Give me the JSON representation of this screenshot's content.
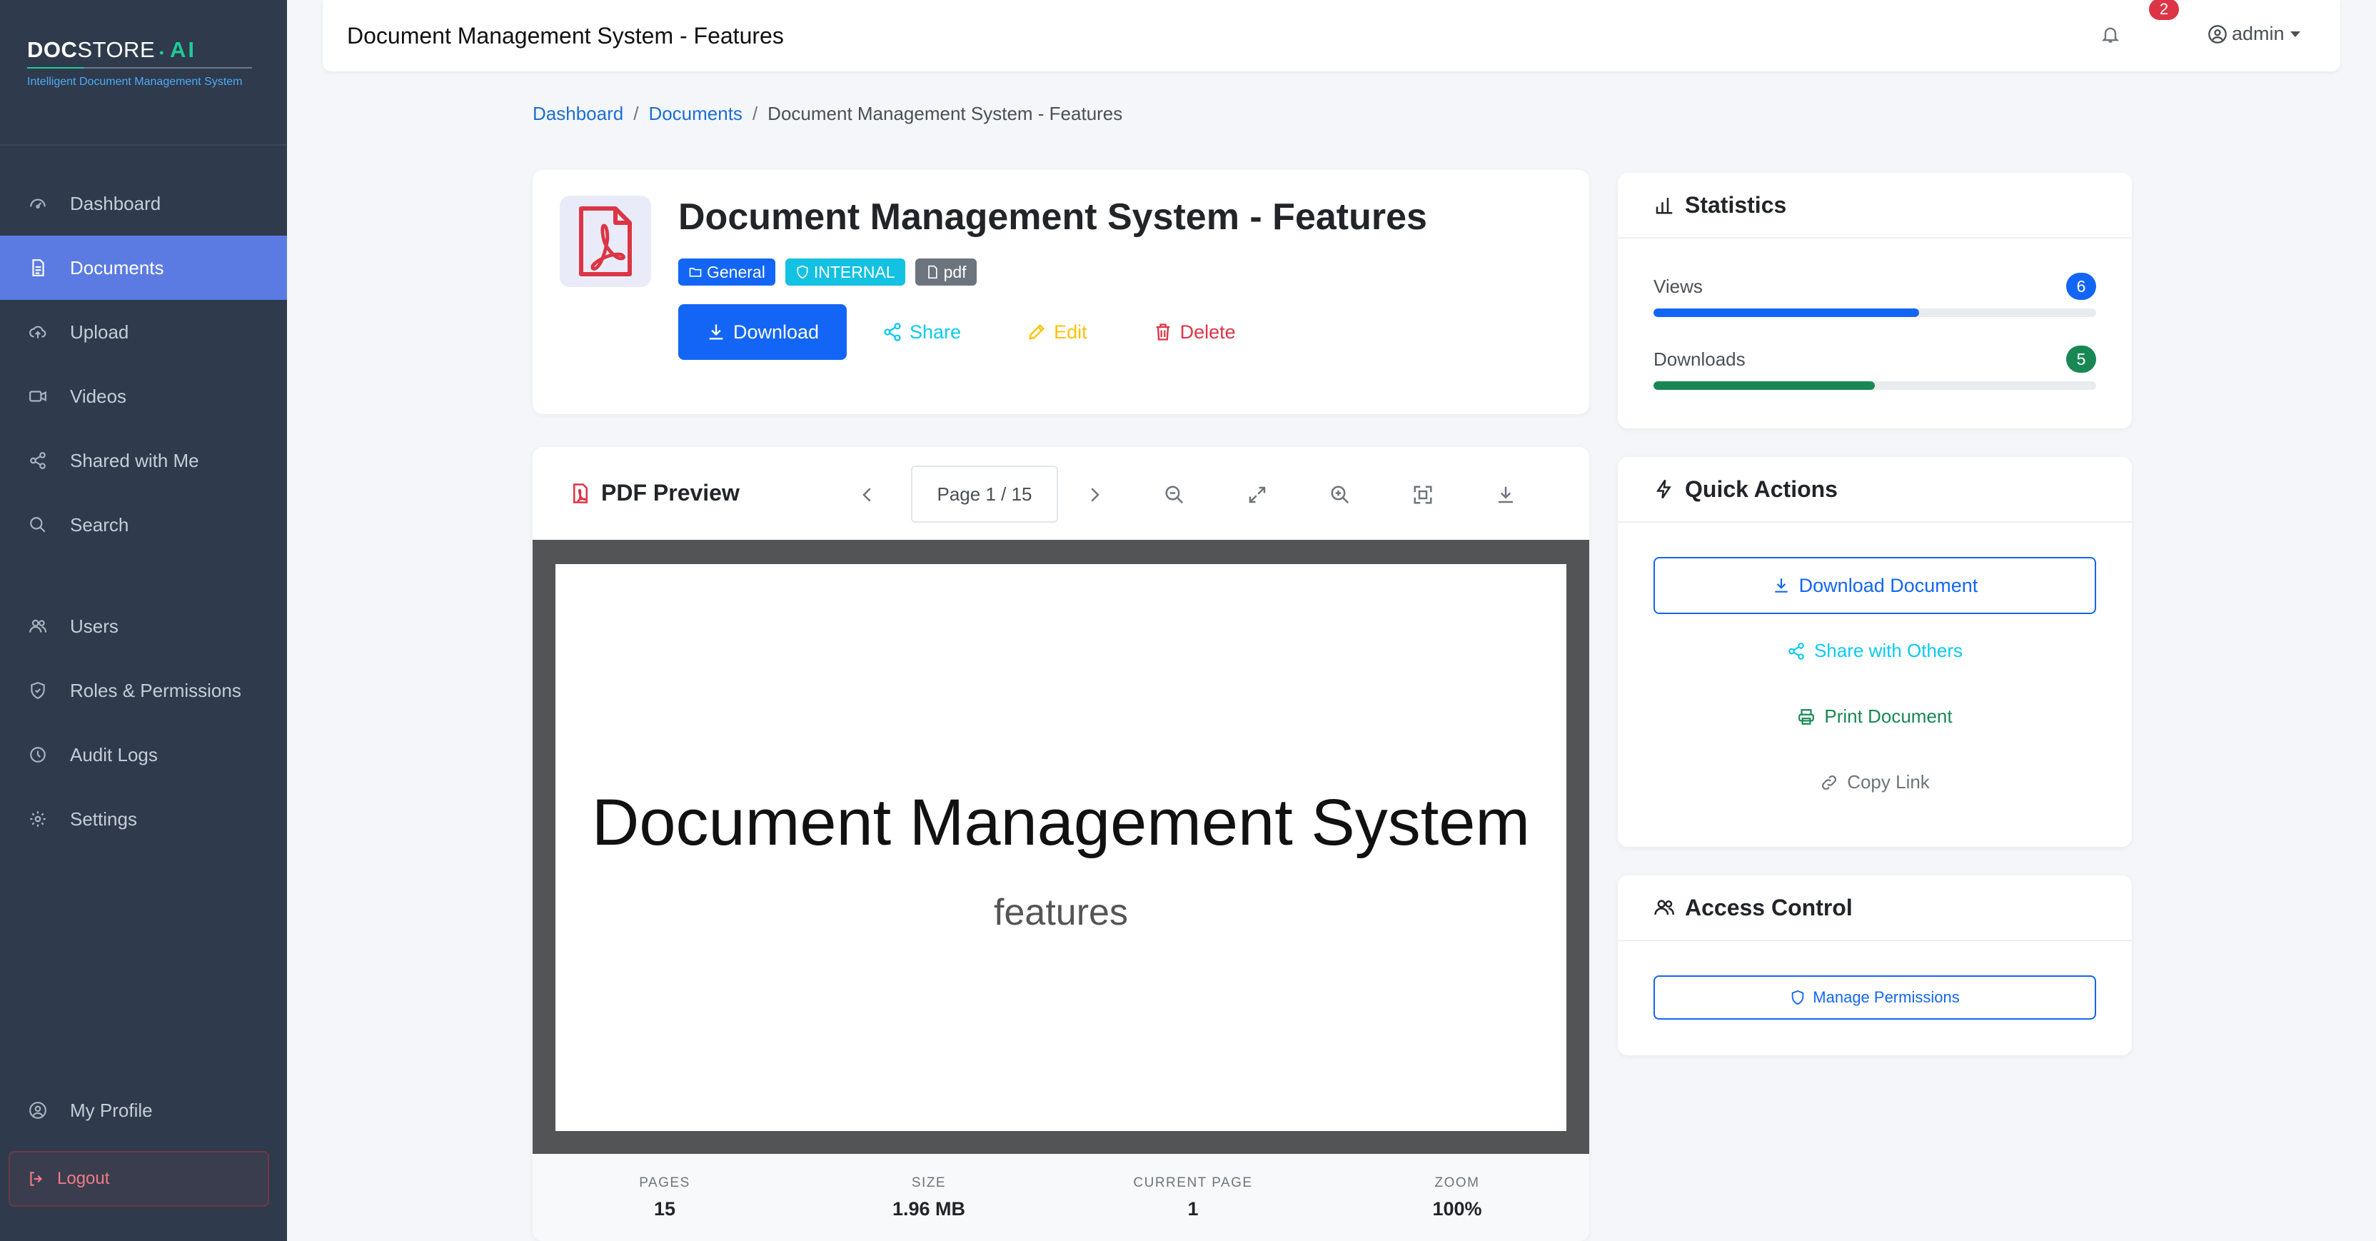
{
  "brand": {
    "doc": "DOC",
    "store": "STORE",
    "dot": "•",
    "ai": "AI",
    "tagline": "Intelligent Document Management System"
  },
  "sidebar": {
    "items": [
      {
        "label": "Dashboard",
        "icon": "dashboard-icon"
      },
      {
        "label": "Documents",
        "icon": "document-icon",
        "active": true
      },
      {
        "label": "Upload",
        "icon": "cloud-upload-icon"
      },
      {
        "label": "Videos",
        "icon": "video-icon"
      },
      {
        "label": "Shared with Me",
        "icon": "share-icon"
      },
      {
        "label": "Search",
        "icon": "search-icon"
      },
      {
        "label": "Users",
        "icon": "users-icon"
      },
      {
        "label": "Roles & Permissions",
        "icon": "shield-icon"
      },
      {
        "label": "Audit Logs",
        "icon": "clock-icon"
      },
      {
        "label": "Settings",
        "icon": "gear-icon"
      }
    ],
    "profile": "My Profile",
    "logout": "Logout"
  },
  "topbar": {
    "title": "Document Management System - Features",
    "notification_count": "2",
    "user": "admin"
  },
  "breadcrumb": {
    "items": [
      "Dashboard",
      "Documents",
      "Document Management System - Features"
    ],
    "separator": "/"
  },
  "document": {
    "title": "Document Management System - Features",
    "tags": [
      "General",
      "INTERNAL",
      "pdf"
    ],
    "actions": {
      "download": "Download",
      "share": "Share",
      "edit": "Edit",
      "delete": "Delete"
    }
  },
  "preview": {
    "label": "PDF Preview",
    "page_indicator": "Page 1 / 15",
    "page_heading": "Document Management System",
    "page_subheading": "features",
    "stats": [
      {
        "key": "PAGES",
        "value": "15"
      },
      {
        "key": "SIZE",
        "value": "1.96 MB"
      },
      {
        "key": "CURRENT PAGE",
        "value": "1"
      },
      {
        "key": "ZOOM",
        "value": "100%"
      }
    ]
  },
  "statistics": {
    "title": "Statistics",
    "views": {
      "label": "Views",
      "count": "6",
      "fraction": 0.6,
      "color": "#1366f5"
    },
    "downloads": {
      "label": "Downloads",
      "count": "5",
      "fraction": 0.5,
      "color": "#198754"
    }
  },
  "quick_actions": {
    "title": "Quick Actions",
    "download": "Download Document",
    "share": "Share with Others",
    "print": "Print Document",
    "copy": "Copy Link"
  },
  "access_control": {
    "title": "Access Control",
    "manage": "Manage Permissions"
  },
  "colors": {
    "sidebar_bg": "#2f3a4c",
    "active": "#5b7be3",
    "primary": "#1366f5",
    "info": "#0dcaf0",
    "warning": "#ffc107",
    "danger": "#dc3545",
    "success": "#198754"
  }
}
